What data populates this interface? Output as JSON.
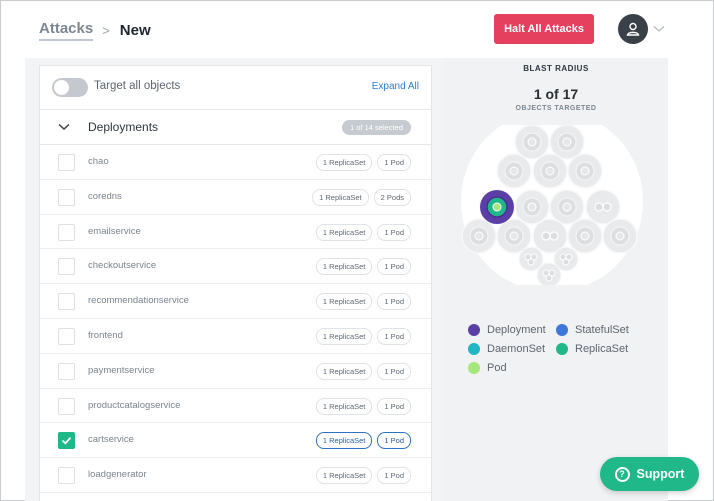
{
  "header": {
    "breadcrumb_root": "Attacks",
    "breadcrumb_separator": ">",
    "breadcrumb_current": "New",
    "halt_button": "Halt All Attacks"
  },
  "targets": {
    "toggle_label": "Target all objects",
    "toggle_on": false,
    "expand_all": "Expand All",
    "group": {
      "title": "Deployments",
      "selected_badge": "1 of 14 selected",
      "expanded": true
    },
    "rows": [
      {
        "name": "chao",
        "replicasets": "1 ReplicaSet",
        "pods": "1 Pod",
        "checked": false
      },
      {
        "name": "coredns",
        "replicasets": "1 ReplicaSet",
        "pods": "2 Pods",
        "checked": false
      },
      {
        "name": "emailservice",
        "replicasets": "1 ReplicaSet",
        "pods": "1 Pod",
        "checked": false
      },
      {
        "name": "checkoutservice",
        "replicasets": "1 ReplicaSet",
        "pods": "1 Pod",
        "checked": false
      },
      {
        "name": "recommendationservice",
        "replicasets": "1 ReplicaSet",
        "pods": "1 Pod",
        "checked": false
      },
      {
        "name": "frontend",
        "replicasets": "1 ReplicaSet",
        "pods": "1 Pod",
        "checked": false
      },
      {
        "name": "paymentservice",
        "replicasets": "1 ReplicaSet",
        "pods": "1 Pod",
        "checked": false
      },
      {
        "name": "productcatalogservice",
        "replicasets": "1 ReplicaSet",
        "pods": "1 Pod",
        "checked": false
      },
      {
        "name": "cartservice",
        "replicasets": "1 ReplicaSet",
        "pods": "1 Pod",
        "checked": true
      },
      {
        "name": "loadgenerator",
        "replicasets": "1 ReplicaSet",
        "pods": "1 Pod",
        "checked": false
      }
    ]
  },
  "blast_radius": {
    "title": "BLAST RADIUS",
    "count": "1 of 17",
    "subtitle": "OBJECTS TARGETED",
    "legend": [
      {
        "label": "Deployment",
        "color": "#5b3fa6"
      },
      {
        "label": "StatefulSet",
        "color": "#3b78d8"
      },
      {
        "label": "DaemonSet",
        "color": "#1fb7c1"
      },
      {
        "label": "ReplicaSet",
        "color": "#21b889"
      },
      {
        "label": "Pod",
        "color": "#a6e67a"
      }
    ]
  },
  "support_button": "Support",
  "colors": {
    "accent_red": "#e5405e",
    "accent_green": "#21b889",
    "link_blue": "#2e7cd6"
  }
}
